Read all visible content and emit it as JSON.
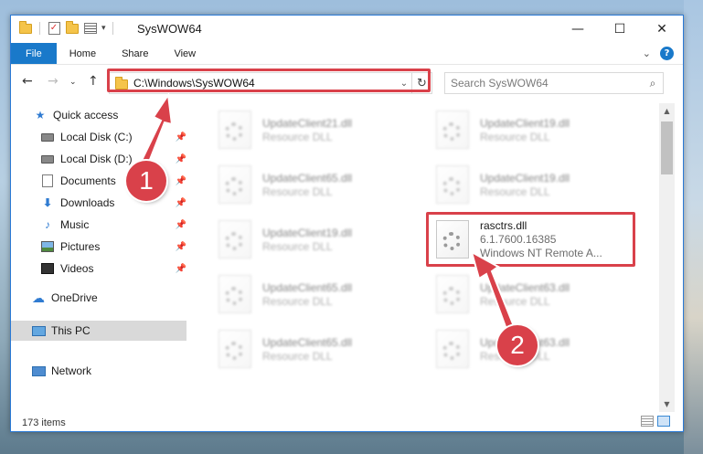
{
  "window": {
    "title": "SysWOW64",
    "controls": {
      "minimize": "—",
      "maximize": "☐",
      "close": "✕"
    }
  },
  "ribbon": {
    "tabs": [
      {
        "label": "File"
      },
      {
        "label": "Home"
      },
      {
        "label": "Share"
      },
      {
        "label": "View"
      }
    ],
    "help": "?"
  },
  "address": {
    "path": "C:\\Windows\\SysWOW64",
    "search_placeholder": "Search SysWOW64"
  },
  "sidebar": {
    "items": [
      {
        "label": "Quick access",
        "icon": "star-icon"
      },
      {
        "label": "Local Disk (C:)",
        "icon": "disk-icon",
        "pinned": true
      },
      {
        "label": "Local Disk (D:)",
        "icon": "disk-icon",
        "pinned": true
      },
      {
        "label": "Documents",
        "icon": "document-icon",
        "pinned": true
      },
      {
        "label": "Downloads",
        "icon": "download-icon",
        "pinned": true
      },
      {
        "label": "Music",
        "icon": "music-icon",
        "pinned": true
      },
      {
        "label": "Pictures",
        "icon": "picture-icon",
        "pinned": true
      },
      {
        "label": "Videos",
        "icon": "video-icon",
        "pinned": true
      },
      {
        "label": "OneDrive",
        "icon": "cloud-icon"
      },
      {
        "label": "This PC",
        "icon": "computer-icon",
        "selected": true
      },
      {
        "label": "Network",
        "icon": "network-icon"
      }
    ]
  },
  "files": [
    {
      "name": "UpdateClient21.dll",
      "desc": "Resource DLL"
    },
    {
      "name": "UpdateClient19.dll",
      "desc": "Resource DLL"
    },
    {
      "name": "UpdateClient65.dll",
      "desc": "Resource DLL"
    },
    {
      "name": "UpdateClient19.dll",
      "desc": "Resource DLL"
    },
    {
      "name": "UpdateClient19.dll",
      "desc": "Resource DLL"
    },
    {
      "name": "rasctrs.dll",
      "version": "6.1.7600.16385",
      "desc": "Windows NT Remote A..."
    },
    {
      "name": "UpdateClient65.dll",
      "desc": "Resource DLL"
    },
    {
      "name": "UpdateClient63.dll",
      "desc": "Resource DLL"
    },
    {
      "name": "UpdateClient65.dll",
      "desc": "Resource DLL"
    },
    {
      "name": "UpdateClient63.dll",
      "desc": "Resource DLL"
    }
  ],
  "status": {
    "item_count": "173 items"
  },
  "annotations": {
    "callout_1": "1",
    "callout_2": "2",
    "color": "#d9414a"
  }
}
